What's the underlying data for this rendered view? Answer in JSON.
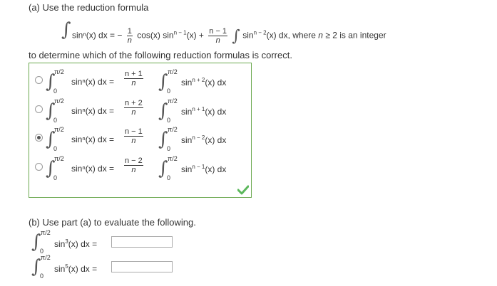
{
  "part_a": {
    "heading": "(a) Use the reduction formula",
    "formula": {
      "lhs": "sinⁿ(x) dx =",
      "minus": "−",
      "frac1_num": "1",
      "frac1_den": "n",
      "term1": "cos(x) sin",
      "term1_exp": "n − 1",
      "term1_end": "(x) +",
      "frac2_num": "n − 1",
      "frac2_den": "n",
      "term2": "sin",
      "term2_exp": "n − 2",
      "term2_end": "(x) dx, where",
      "cond_var": "n",
      "cond_rest": "≥ 2 is an integer"
    },
    "instruction": "to determine which of the following reduction formulas is correct.",
    "options": [
      {
        "upper": "π/2",
        "lower": "0",
        "lhs": "sinⁿ(x) dx =",
        "num": "n + 1",
        "den": "n",
        "rhs_pre": "sin",
        "rhs_exp": "n + 2",
        "rhs_post": "(x) dx",
        "selected": false
      },
      {
        "upper": "π/2",
        "lower": "0",
        "lhs": "sinⁿ(x) dx =",
        "num": "n + 2",
        "den": "n",
        "rhs_pre": "sin",
        "rhs_exp": "n + 1",
        "rhs_post": "(x) dx",
        "selected": false
      },
      {
        "upper": "π/2",
        "lower": "0",
        "lhs": "sinⁿ(x) dx =",
        "num": "n − 1",
        "den": "n",
        "rhs_pre": "sin",
        "rhs_exp": "n − 2",
        "rhs_post": "(x) dx",
        "selected": true
      },
      {
        "upper": "π/2",
        "lower": "0",
        "lhs": "sinⁿ(x) dx =",
        "num": "n − 2",
        "den": "n",
        "rhs_pre": "sin",
        "rhs_exp": "n − 1",
        "rhs_post": "(x) dx",
        "selected": false
      }
    ],
    "correct_icon": "checkmark-icon",
    "correct_color": "#5cb85c",
    "border_color": "#6aa84f"
  },
  "part_b": {
    "heading": "(b) Use part (a) to evaluate the following.",
    "items": [
      {
        "upper": "π/2",
        "lower": "0",
        "expr_pre": "sin",
        "expr_exp": "3",
        "expr_post": "(x) dx =",
        "value": ""
      },
      {
        "upper": "π/2",
        "lower": "0",
        "expr_pre": "sin",
        "expr_exp": "5",
        "expr_post": "(x) dx =",
        "value": ""
      }
    ]
  }
}
